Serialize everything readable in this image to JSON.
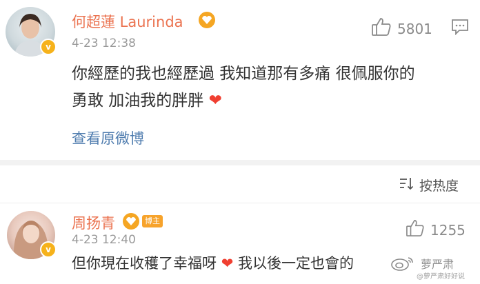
{
  "comments": [
    {
      "user": "何超蓮 Laurinda",
      "time": "4-23 12:38",
      "likes": "5801",
      "text_line1": "你經歷的我也經歷過 我知道那有多痛 很佩服你的",
      "text_line2": "勇敢 加油我的胖胖",
      "heart": "❤",
      "view_original": "查看原微博",
      "verified_badge": "v",
      "fan_icon": "fan-medal-icon"
    },
    {
      "user": "周扬青",
      "time": "4-23 12:40",
      "likes": "1255",
      "host_badge": "博主",
      "text_part1": "但你現在收穫了幸福呀",
      "heart": "❤",
      "text_part2": "我以後一定也會的",
      "verified_badge": "v",
      "fan_icon": "fan-medal-icon"
    }
  ],
  "sort": {
    "label": "按热度",
    "icon": "sort-icon"
  },
  "watermark": {
    "text": "萝严肃",
    "sub": "@萝严肃好好说"
  },
  "colors": {
    "name": "#eb7350",
    "link": "#507daf",
    "heart": "#f03f31",
    "badge": "#f6b21b",
    "meta": "#999999",
    "text": "#333333"
  }
}
